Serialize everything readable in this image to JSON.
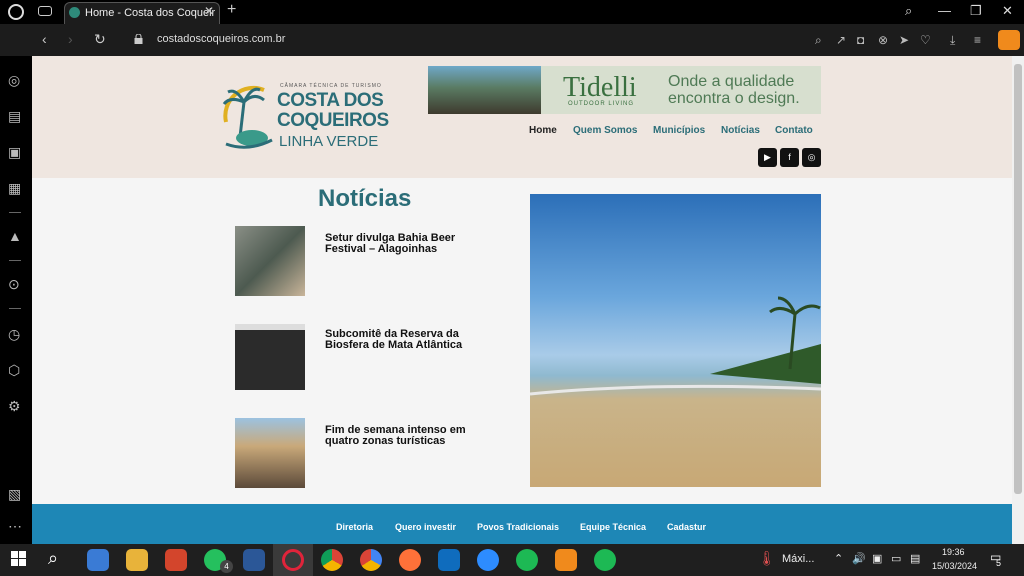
{
  "browser": {
    "tab_title": "Home - Costa dos Coqueir",
    "url": "costadoscoqueiros.com.br"
  },
  "site": {
    "logo": {
      "small": "CÂMARA TÉCNICA DE TURISMO",
      "line1": "COSTA DOS",
      "line2": "COQUEIROS",
      "line3": "LINHA VERDE"
    },
    "ad": {
      "brand": "Tidelli",
      "sub": "OUTDOOR LIVING",
      "slogan1": "Onde a qualidade",
      "slogan2": "encontra o design."
    },
    "nav": [
      "Home",
      "Quem Somos",
      "Municípios",
      "Notícias",
      "Contato"
    ],
    "news_title": "Notícias",
    "news": [
      {
        "title": "Setur divulga Bahia Beer Festival – Alagoinhas"
      },
      {
        "title": "Subcomitê da Reserva da Biosfera de Mata Atlântica"
      },
      {
        "title": "Fim de semana intenso em quatro zonas turísticas"
      }
    ],
    "footer": [
      "Diretoria",
      "Quero investir",
      "Povos Tradicionais",
      "Equipe Técnica",
      "Cadastur"
    ]
  },
  "taskbar": {
    "whatsapp_badge": "4",
    "weather": "Máxi...",
    "time": "19:36",
    "date": "15/03/2024",
    "notifications": "5"
  },
  "colors": {
    "brand": "#2b6d78",
    "footer": "#1e87b6",
    "header_bg": "#efe6e0"
  }
}
